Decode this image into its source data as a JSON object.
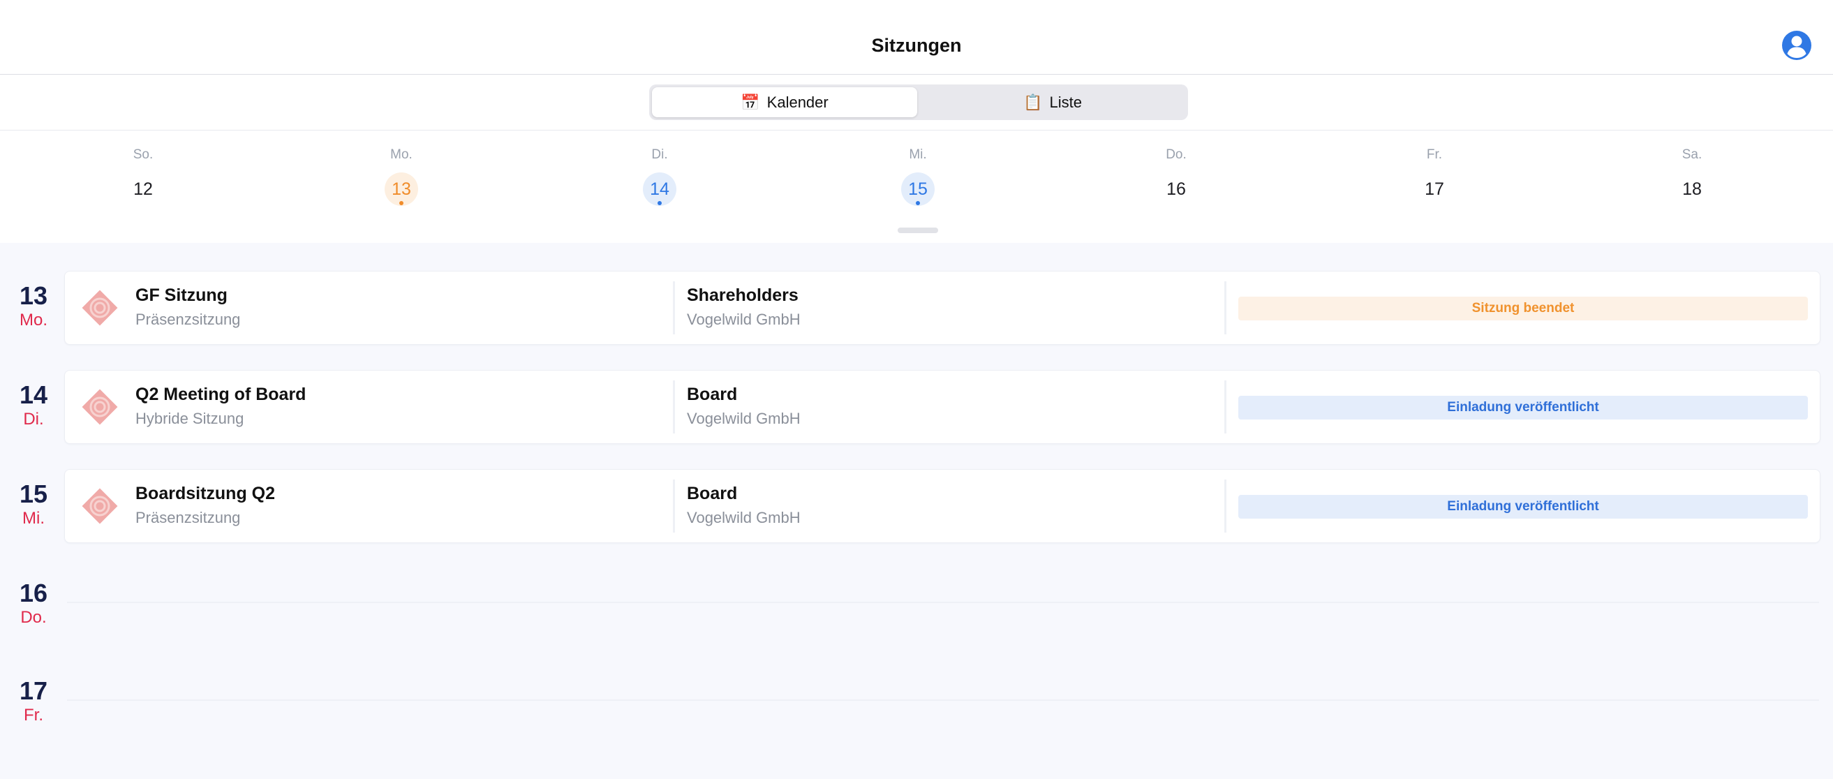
{
  "header": {
    "title": "Sitzungen"
  },
  "view_toggle": {
    "calendar_icon": "📅",
    "calendar_label": "Kalender",
    "list_icon": "📋",
    "list_label": "Liste"
  },
  "week": [
    {
      "weekday": "So.",
      "day": "12",
      "state": "normal"
    },
    {
      "weekday": "Mo.",
      "day": "13",
      "state": "orange"
    },
    {
      "weekday": "Di.",
      "day": "14",
      "state": "blue"
    },
    {
      "weekday": "Mi.",
      "day": "15",
      "state": "blue"
    },
    {
      "weekday": "Do.",
      "day": "16",
      "state": "normal"
    },
    {
      "weekday": "Fr.",
      "day": "17",
      "state": "normal"
    },
    {
      "weekday": "Sa.",
      "day": "18",
      "state": "normal"
    }
  ],
  "agenda": [
    {
      "date_num": "13",
      "date_wd": "Mo.",
      "title": "GF Sitzung",
      "subtitle": "Präsenzsitzung",
      "group": "Shareholders",
      "company": "Vogelwild GmbH",
      "status": "Sitzung beendet",
      "status_type": "ended"
    },
    {
      "date_num": "14",
      "date_wd": "Di.",
      "title": "Q2 Meeting of Board",
      "subtitle": "Hybride Sitzung",
      "group": "Board",
      "company": "Vogelwild GmbH",
      "status": "Einladung veröffentlicht",
      "status_type": "published"
    },
    {
      "date_num": "15",
      "date_wd": "Mi.",
      "title": "Boardsitzung Q2",
      "subtitle": "Präsenzsitzung",
      "group": "Board",
      "company": "Vogelwild GmbH",
      "status": "Einladung veröffentlicht",
      "status_type": "published"
    }
  ],
  "empty_days": [
    {
      "date_num": "16",
      "date_wd": "Do."
    },
    {
      "date_num": "17",
      "date_wd": "Fr."
    }
  ],
  "colors": {
    "accent_blue": "#2f78e4",
    "accent_orange": "#f08c2a",
    "weekday_red": "#e0294b",
    "date_navy": "#172049"
  }
}
